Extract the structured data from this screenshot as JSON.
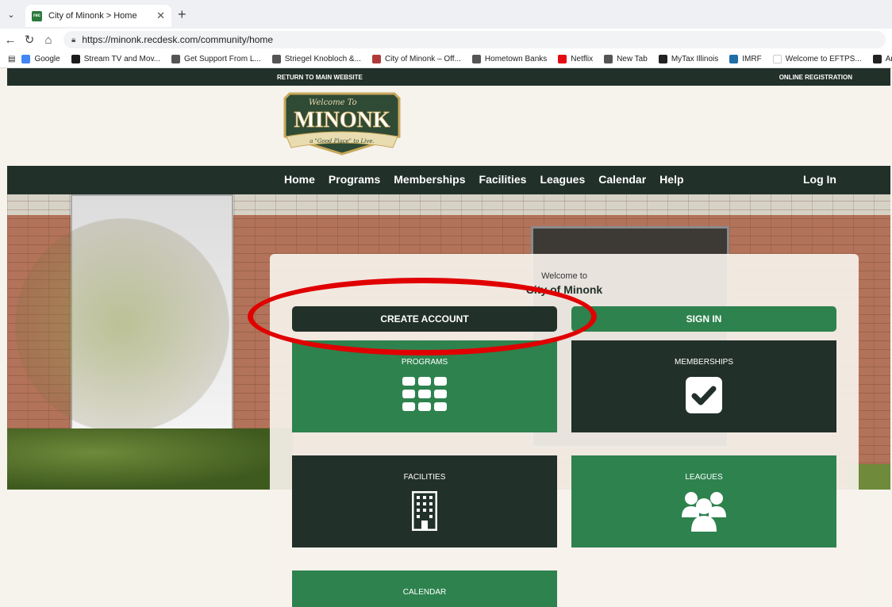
{
  "browser": {
    "tab_title": "City of Minonk > Home",
    "tab_favicon_text": "rec",
    "url": "https://minonk.recdesk.com/community/home",
    "bookmarks": [
      {
        "label": "Google",
        "icon": "google-icon",
        "color": "#4285f4"
      },
      {
        "label": "Stream TV and Mov...",
        "icon": "hulu-icon",
        "color": "#1b1b1b"
      },
      {
        "label": "Get Support From L...",
        "icon": "support-icon",
        "color": "#555555"
      },
      {
        "label": "Striegel Knobloch &...",
        "icon": "globe-icon",
        "color": "#555555"
      },
      {
        "label": "City of Minonk – Off...",
        "icon": "minonk-icon",
        "color": "#b03a3a"
      },
      {
        "label": "Hometown Banks",
        "icon": "bank-icon",
        "color": "#555555"
      },
      {
        "label": "Netflix",
        "icon": "netflix-icon",
        "color": "#e50914"
      },
      {
        "label": "New Tab",
        "icon": "globe-icon",
        "color": "#555555"
      },
      {
        "label": "MyTax Illinois",
        "icon": "illinois-icon",
        "color": "#222222"
      },
      {
        "label": "IMRF",
        "icon": "imrf-icon",
        "color": "#1f6ea8"
      },
      {
        "label": "Welcome to EFTPS...",
        "icon": "eftps-icon",
        "color": "#ffffff"
      },
      {
        "label": "Amazon Business",
        "icon": "amazon-icon",
        "color": "#222222"
      }
    ]
  },
  "site": {
    "return_link": "RETURN TO MAIN WEBSITE",
    "online_registration": "ONLINE REGISTRATION",
    "logo": {
      "top": "Welcome To",
      "name": "MINONK",
      "ribbon": "a \"Good Place\" to Live."
    },
    "nav": [
      "Home",
      "Programs",
      "Memberships",
      "Facilities",
      "Leagues",
      "Calendar",
      "Help"
    ],
    "login": "Log In",
    "welcome_small": "Welcome to",
    "welcome_big": "City of Minonk",
    "buttons": {
      "create": "CREATE ACCOUNT",
      "signin": "SIGN IN"
    },
    "tiles": {
      "programs": "PROGRAMS",
      "memberships": "MEMBERSHIPS",
      "facilities": "FACILITIES",
      "leagues": "LEAGUES",
      "calendar": "CALENDAR"
    }
  },
  "colors": {
    "dark_green": "#22302a",
    "brand_green": "#2e824e",
    "highlight_red": "#e00000"
  }
}
